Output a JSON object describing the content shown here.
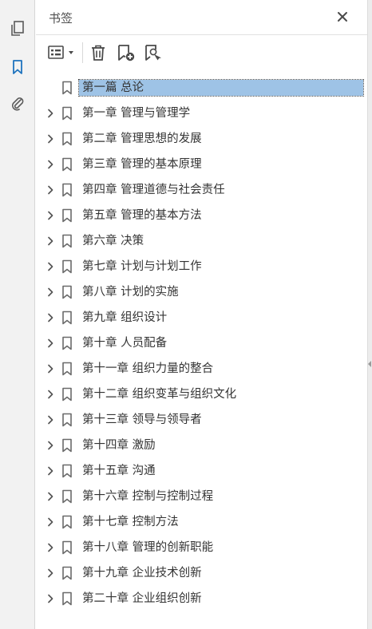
{
  "panel": {
    "title": "书签"
  },
  "rail": [
    {
      "name": "pages-icon"
    },
    {
      "name": "bookmarks-icon"
    },
    {
      "name": "attachments-icon"
    }
  ],
  "colors": {
    "accent": "#1e73be",
    "selection": "#9ec3e6",
    "icon": "#5a5a5a"
  },
  "bookmarks": [
    {
      "label": "第一篇  总论",
      "expandable": false,
      "selected": true
    },
    {
      "label": "第一章  管理与管理学",
      "expandable": true,
      "selected": false
    },
    {
      "label": "第二章  管理思想的发展",
      "expandable": true,
      "selected": false
    },
    {
      "label": "第三章  管理的基本原理",
      "expandable": true,
      "selected": false
    },
    {
      "label": "第四章  管理道德与社会责任",
      "expandable": true,
      "selected": false
    },
    {
      "label": "第五章  管理的基本方法",
      "expandable": true,
      "selected": false
    },
    {
      "label": "第六章  决策",
      "expandable": true,
      "selected": false
    },
    {
      "label": "第七章  计划与计划工作",
      "expandable": true,
      "selected": false
    },
    {
      "label": "第八章  计划的实施",
      "expandable": true,
      "selected": false
    },
    {
      "label": "第九章  组织设计",
      "expandable": true,
      "selected": false
    },
    {
      "label": "第十章  人员配备",
      "expandable": true,
      "selected": false
    },
    {
      "label": "第十一章  组织力量的整合",
      "expandable": true,
      "selected": false
    },
    {
      "label": "第十二章  组织变革与组织文化",
      "expandable": true,
      "selected": false
    },
    {
      "label": "第十三章  领导与领导者",
      "expandable": true,
      "selected": false
    },
    {
      "label": "第十四章  激励",
      "expandable": true,
      "selected": false
    },
    {
      "label": "第十五章  沟通",
      "expandable": true,
      "selected": false
    },
    {
      "label": "第十六章  控制与控制过程",
      "expandable": true,
      "selected": false
    },
    {
      "label": "第十七章  控制方法",
      "expandable": true,
      "selected": false
    },
    {
      "label": "第十八章  管理的创新职能",
      "expandable": true,
      "selected": false
    },
    {
      "label": "第十九章  企业技术创新",
      "expandable": true,
      "selected": false
    },
    {
      "label": "第二十章  企业组织创新",
      "expandable": true,
      "selected": false
    }
  ]
}
